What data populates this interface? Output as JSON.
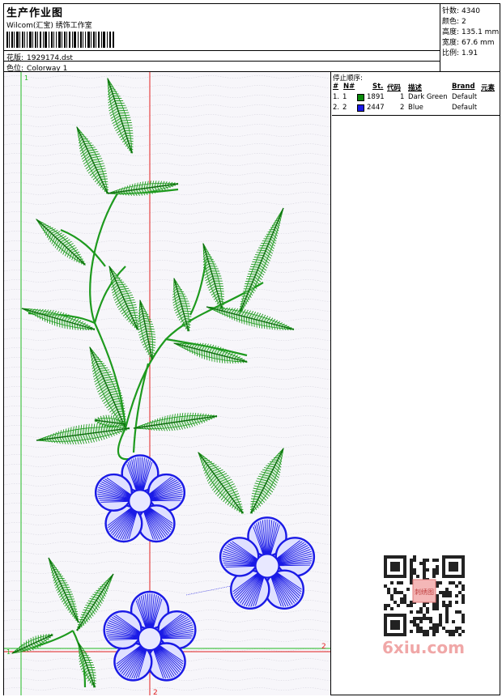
{
  "header": {
    "title": "生产作业图",
    "company": "Wilcom(汇宝) 绣饰工作室",
    "design_label": "花版:",
    "design_value": "1929174.dst",
    "colorway_label": "色位:",
    "colorway_value": "Colorway 1"
  },
  "stats": [
    {
      "label": "针数:",
      "value": "4340"
    },
    {
      "label": "颜色:",
      "value": "2"
    },
    {
      "label": "高度:",
      "value": "135.1 mm"
    },
    {
      "label": "宽度:",
      "value": "67.6 mm"
    },
    {
      "label": "比例:",
      "value": "1.91"
    }
  ],
  "stop_sequence": {
    "title": "停止顺序:",
    "headers": [
      "#",
      "N#",
      "St.",
      "代码",
      "描述",
      "Brand",
      "元素"
    ],
    "rows": [
      {
        "num": "1.",
        "n": "1",
        "color": "#0a8a0a",
        "st": "1891",
        "code": "1",
        "desc": "Dark Green",
        "brand": "Default"
      },
      {
        "num": "2.",
        "n": "2",
        "color": "#1a1ae6",
        "st": "2447",
        "code": "2",
        "desc": "Blue",
        "brand": "Default"
      }
    ]
  },
  "canvas": {
    "marker_top": "1",
    "marker_left": "1",
    "marker_right": "2",
    "marker_bottom": "2",
    "green_color": "#1e9a1e",
    "blue_color": "#1a1ae6",
    "guide_green": "#22bb22",
    "guide_red": "#e02020"
  },
  "watermark": {
    "text": "6xiu.com",
    "seal_text": "刺绣图"
  }
}
